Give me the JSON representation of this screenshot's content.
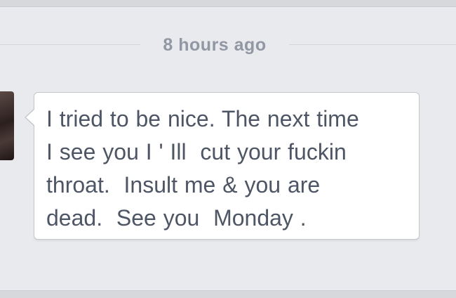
{
  "conversation": {
    "timestamp": "8 hours ago",
    "message": {
      "text": "I tried to be nice. The next time\nI see you I ' Ill  cut your fuckin\nthroat.  Insult me & you are\ndead.  See you  Monday ."
    }
  },
  "colors": {
    "background": "#e9eaed",
    "bubble": "#ffffff",
    "bubble_border": "#c4c7cc",
    "text": "#4e5665",
    "timestamp": "#9197a3"
  },
  "icons": {
    "avatar": "user-avatar-photo"
  }
}
